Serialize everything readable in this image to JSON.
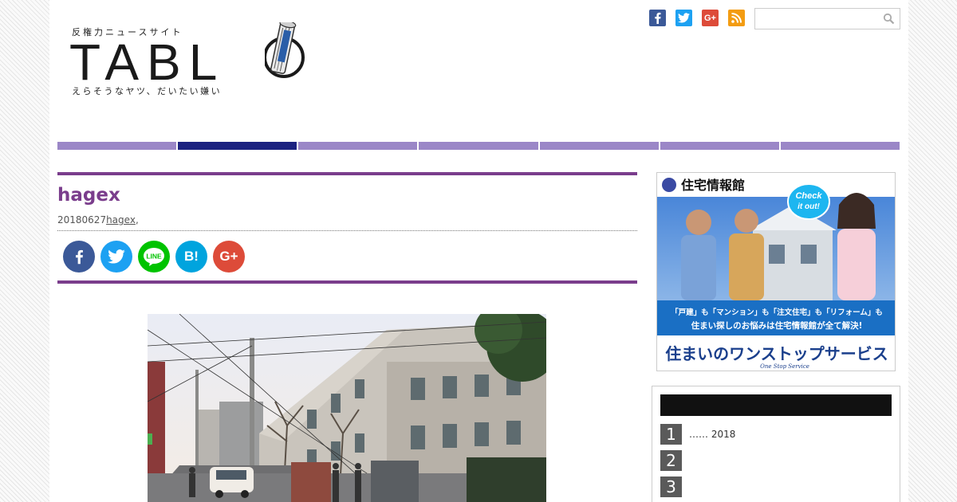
{
  "header": {
    "tagline_top": "反権力ニュースサイト",
    "logo_text": "TABL",
    "tagline_bottom": "えらそうなヤツ、だいたい嫌い",
    "search": {
      "placeholder": ""
    },
    "social": [
      {
        "name": "facebook-icon",
        "label": "f",
        "color": "#3b5998"
      },
      {
        "name": "twitter-icon",
        "label": "t",
        "color": "#1da1f2"
      },
      {
        "name": "google-plus-icon",
        "label": "G+",
        "color": "#dd4b39"
      },
      {
        "name": "rss-icon",
        "label": "rss",
        "color": "#f39c12"
      }
    ]
  },
  "nav": {
    "segments": 7,
    "active_index": 1
  },
  "article": {
    "title": "hagex",
    "date": "20180627",
    "author_link": "hagex",
    "author_suffix": ",",
    "share_buttons": [
      {
        "name": "facebook-share-button",
        "label": "f",
        "color": "#3b5998"
      },
      {
        "name": "twitter-share-button",
        "label": "t",
        "color": "#1da1f2"
      },
      {
        "name": "line-share-button",
        "label": "LINE",
        "color": "#00c300"
      },
      {
        "name": "hatena-share-button",
        "label": "B!",
        "color": "#00a4de"
      },
      {
        "name": "google-plus-share-button",
        "label": "G+",
        "color": "#dd4b39"
      }
    ]
  },
  "ad": {
    "brand": "住宅情報館",
    "badge_line1": "Check",
    "badge_line2": "it out!",
    "copy_line1": "「戸建」も「マンション」も「注文住宅」も「リフォーム」も",
    "copy_line2": "住まい探しのお悩みは住宅情報館が全て解決!",
    "slogan": "住まいのワンストップサービス",
    "slogan_sub": "One Stop Service"
  },
  "ranking": {
    "heading": "",
    "items": [
      {
        "rank": "1",
        "text": "……  2018"
      },
      {
        "rank": "2",
        "text": ""
      },
      {
        "rank": "3",
        "text": ""
      }
    ]
  },
  "colors": {
    "accent": "#7a3d8c",
    "nav": "#9b87c7",
    "nav_active": "#1c2280"
  }
}
